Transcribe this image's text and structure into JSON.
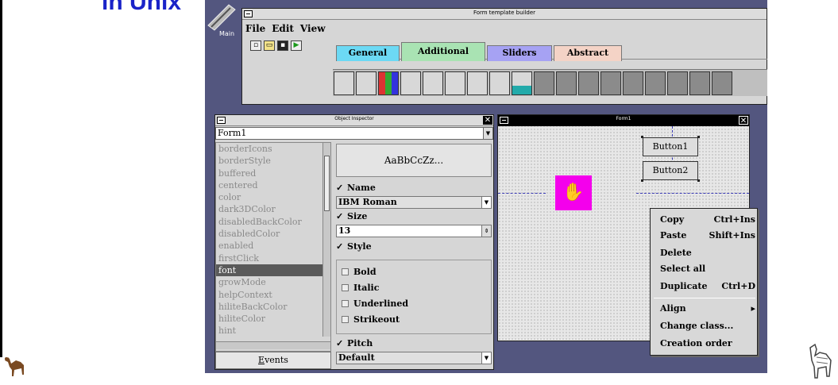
{
  "slide": {
    "title": "in Unix"
  },
  "desktop_icon": {
    "label": "Main"
  },
  "builder": {
    "title": "Form template builder",
    "menu": [
      "File",
      "Edit",
      "View"
    ],
    "tabs": [
      "General",
      "Additional",
      "Sliders",
      "Abstract"
    ],
    "active_tab": "Additional",
    "colors": {
      "general": "#6cd9f4",
      "additional": "#a9e3b3",
      "sliders": "#a6a2f3",
      "abstract": "#f4d3c6"
    }
  },
  "inspector": {
    "title": "Object Inspector",
    "selected_object": "Form1",
    "properties": [
      "borderIcons",
      "borderStyle",
      "buffered",
      "centered",
      "color",
      "dark3DColor",
      "disabledBackColor",
      "disabledColor",
      "enabled",
      "firstClick",
      "font",
      "growMode",
      "helpContext",
      "hiliteBackColor",
      "hiliteColor",
      "hint"
    ],
    "selected_property": "font",
    "events_tab": "Events",
    "font_editor": {
      "preview": "AaBbCcZz...",
      "name_label": "Name",
      "name_value": "IBM Roman",
      "size_label": "Size",
      "size_value": "13",
      "style_label": "Style",
      "styles": [
        "Bold",
        "Italic",
        "Underlined",
        "Strikeout"
      ],
      "pitch_label": "Pitch",
      "pitch_value": "Default"
    }
  },
  "form1": {
    "title": "Form1",
    "buttons": [
      "Button1",
      "Button2"
    ],
    "hand_color": "#f400ec"
  },
  "context_menu": {
    "items": [
      {
        "label": "Copy",
        "shortcut": "Ctrl+Ins"
      },
      {
        "label": "Paste",
        "shortcut": "Shift+Ins"
      },
      {
        "label": "Delete",
        "shortcut": ""
      },
      {
        "label": "Select all",
        "shortcut": ""
      },
      {
        "label": "Duplicate",
        "shortcut": "Ctrl+D"
      },
      {
        "label": "Align",
        "shortcut": "▸"
      },
      {
        "label": "Change class...",
        "shortcut": ""
      },
      {
        "label": "Creation order",
        "shortcut": ""
      }
    ]
  }
}
